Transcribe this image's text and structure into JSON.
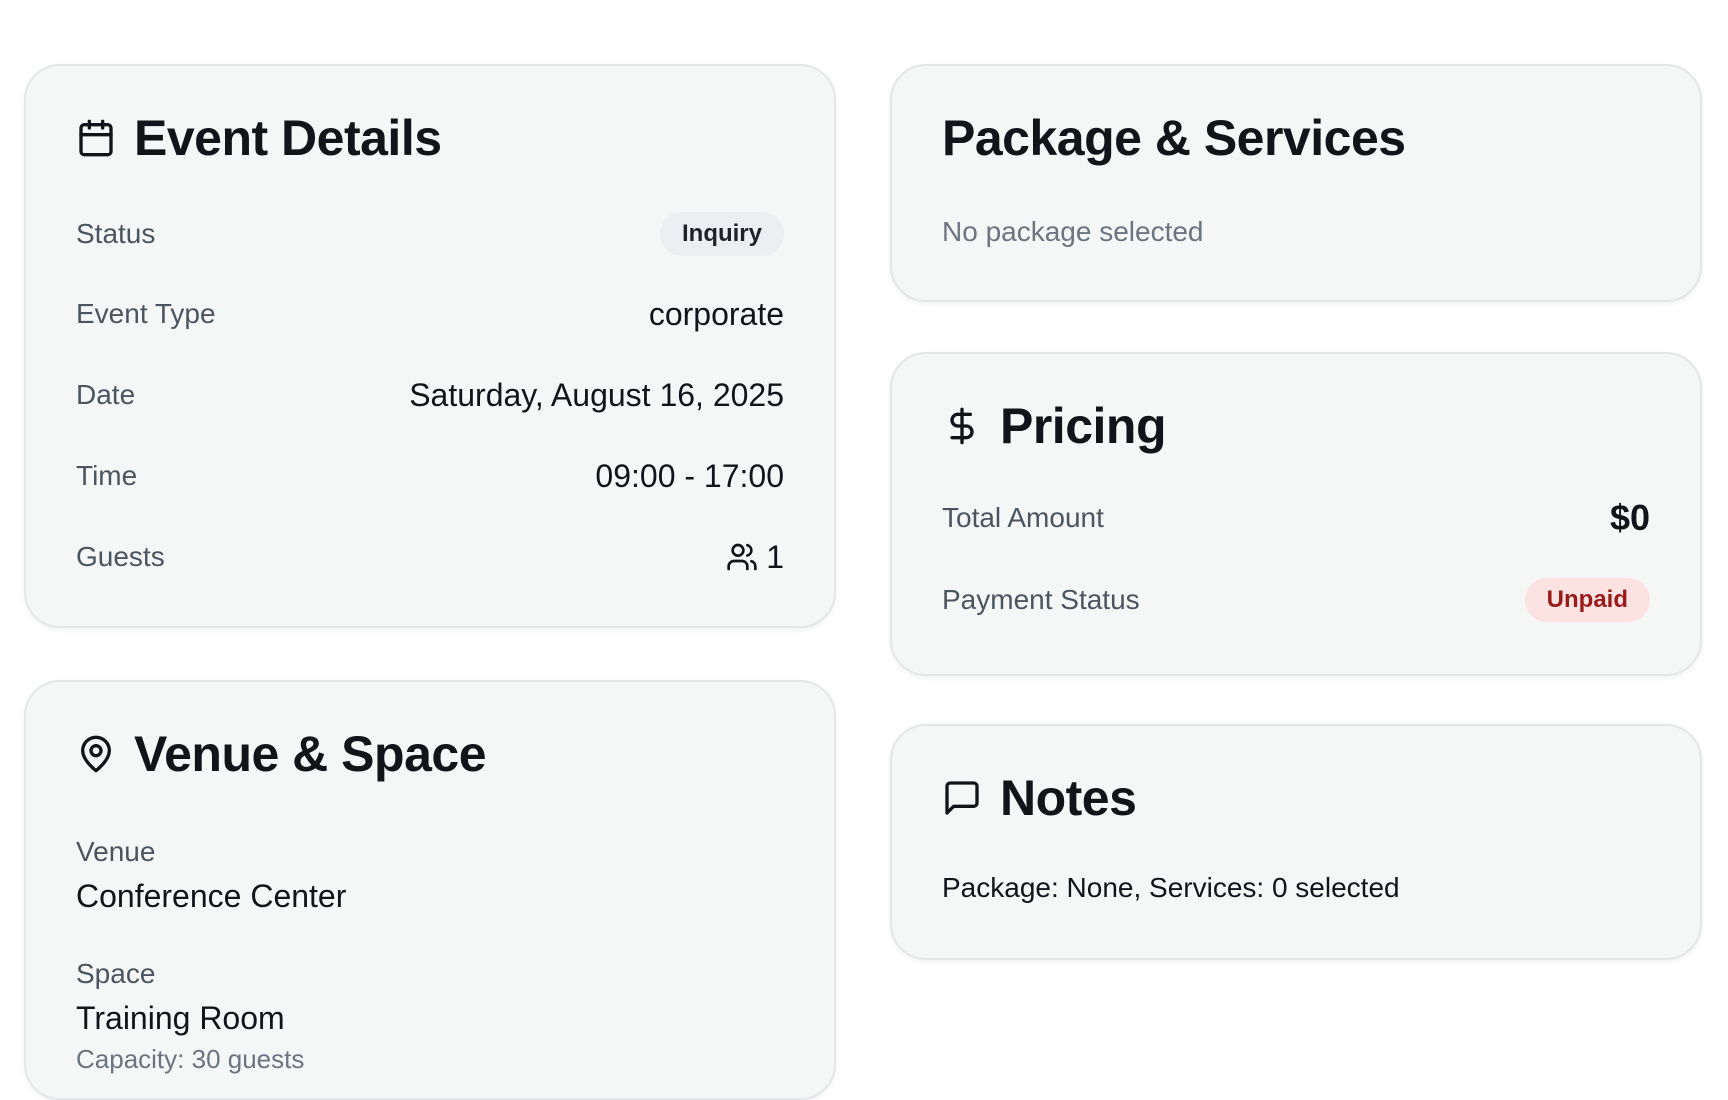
{
  "event_details": {
    "title": "Event Details",
    "icon": "calendar-icon",
    "rows": {
      "status_label": "Status",
      "status_value": "Inquiry",
      "event_type_label": "Event Type",
      "event_type_value": "corporate",
      "date_label": "Date",
      "date_value": "Saturday, August 16, 2025",
      "time_label": "Time",
      "time_value": "09:00 - 17:00",
      "guests_label": "Guests",
      "guests_value": "1"
    }
  },
  "venue_space": {
    "title": "Venue & Space",
    "icon": "map-pin-icon",
    "venue_label": "Venue",
    "venue_value": "Conference Center",
    "space_label": "Space",
    "space_value": "Training Room",
    "capacity_text": "Capacity: 30 guests"
  },
  "package_services": {
    "title": "Package & Services",
    "empty_text": "No package selected"
  },
  "pricing": {
    "title": "Pricing",
    "icon": "dollar-icon",
    "total_label": "Total Amount",
    "total_value": "$0",
    "payment_label": "Payment Status",
    "payment_value": "Unpaid"
  },
  "notes": {
    "title": "Notes",
    "icon": "message-square-icon",
    "text": "Package: None, Services: 0 selected"
  },
  "colors": {
    "card_bg": "#f5f7f7",
    "card_border": "#e3e7e8",
    "unpaid_bg": "#fde2e2",
    "unpaid_text": "#991b1b",
    "inquiry_bg": "#eceff2"
  }
}
